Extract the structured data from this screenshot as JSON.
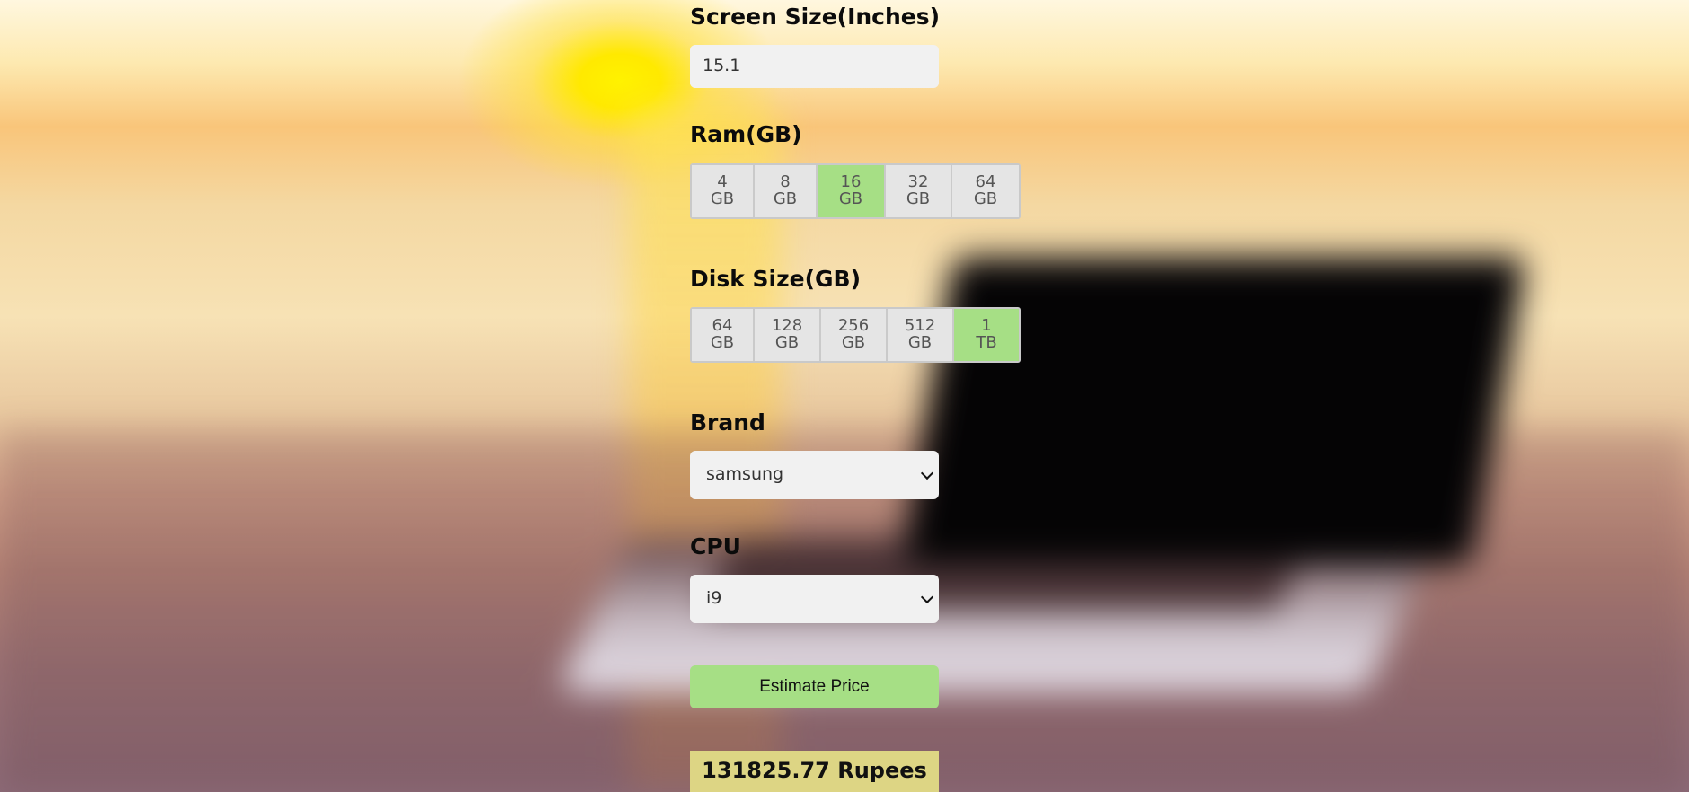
{
  "screen_size": {
    "label": "Screen Size(Inches)",
    "value": "15.1"
  },
  "ram": {
    "label": "Ram(GB)",
    "options": [
      {
        "num": "4",
        "unit": "GB",
        "selected": false
      },
      {
        "num": "8",
        "unit": "GB",
        "selected": false
      },
      {
        "num": "16",
        "unit": "GB",
        "selected": true
      },
      {
        "num": "32",
        "unit": "GB",
        "selected": false
      },
      {
        "num": "64",
        "unit": "GB",
        "selected": false
      }
    ]
  },
  "disk": {
    "label": "Disk Size(GB)",
    "options": [
      {
        "num": "64",
        "unit": "GB",
        "selected": false
      },
      {
        "num": "128",
        "unit": "GB",
        "selected": false
      },
      {
        "num": "256",
        "unit": "GB",
        "selected": false
      },
      {
        "num": "512",
        "unit": "GB",
        "selected": false
      },
      {
        "num": "1",
        "unit": "TB",
        "selected": true
      }
    ]
  },
  "brand": {
    "label": "Brand",
    "value": "samsung"
  },
  "cpu": {
    "label": "CPU",
    "value": "i9"
  },
  "estimate_button": "Estimate Price",
  "result_text": "131825.77 Rupees",
  "colors": {
    "selected": "#a6df85",
    "result_bg": "#ddd584"
  }
}
